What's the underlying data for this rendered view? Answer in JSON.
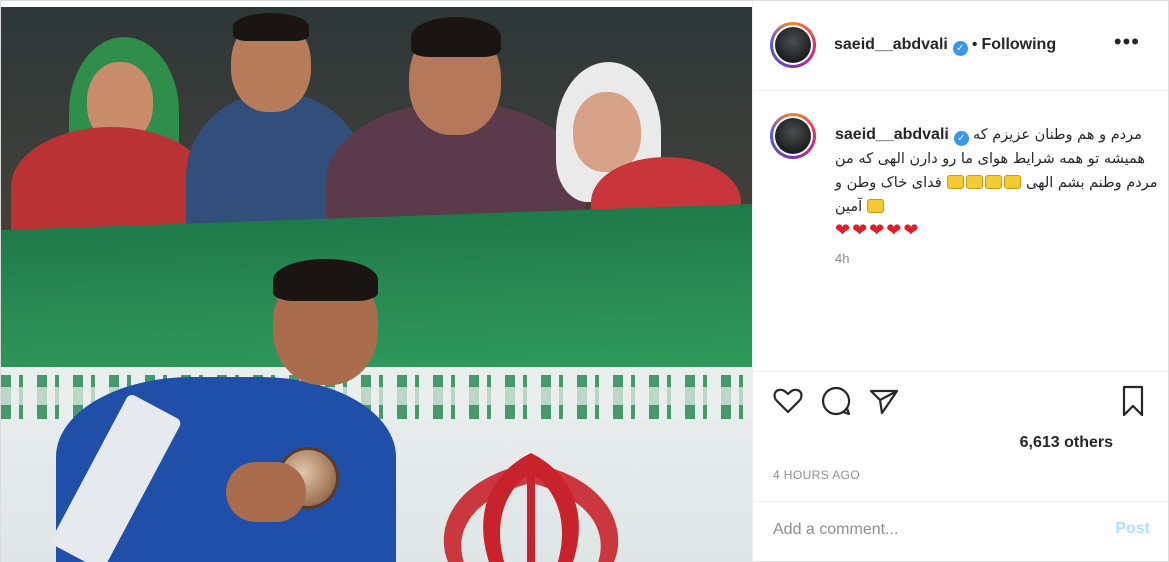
{
  "post": {
    "author": {
      "username": "saeid__abdvali",
      "verified": true,
      "follow_status": "Following",
      "separator": "•"
    },
    "more_menu_glyph": "•••",
    "caption": {
      "username": "saeid__abdvali",
      "text": "مردم و هم وطنان عزیزم که همیشه تو همه شرایط هوای ما رو دارن الهی که من فدای خاک وطن و",
      "text_tail": "مردم وطنم بشم الهی آمین",
      "hearts": "❤❤❤❤❤",
      "relative_time": "4h"
    },
    "actions": {
      "like_icon": "heart-icon",
      "comment_icon": "comment-icon",
      "share_icon": "paper-plane-icon",
      "save_icon": "bookmark-icon"
    },
    "likes_text": "6,613 others",
    "timestamp": "4 HOURS AGO",
    "comment": {
      "placeholder": "Add a comment...",
      "post_label": "Post"
    }
  },
  "colors": {
    "verified_blue": "#3897f0",
    "post_disabled": "#b2dffc",
    "heart_red": "#e11d2a",
    "muted": "#8e8e8e"
  }
}
